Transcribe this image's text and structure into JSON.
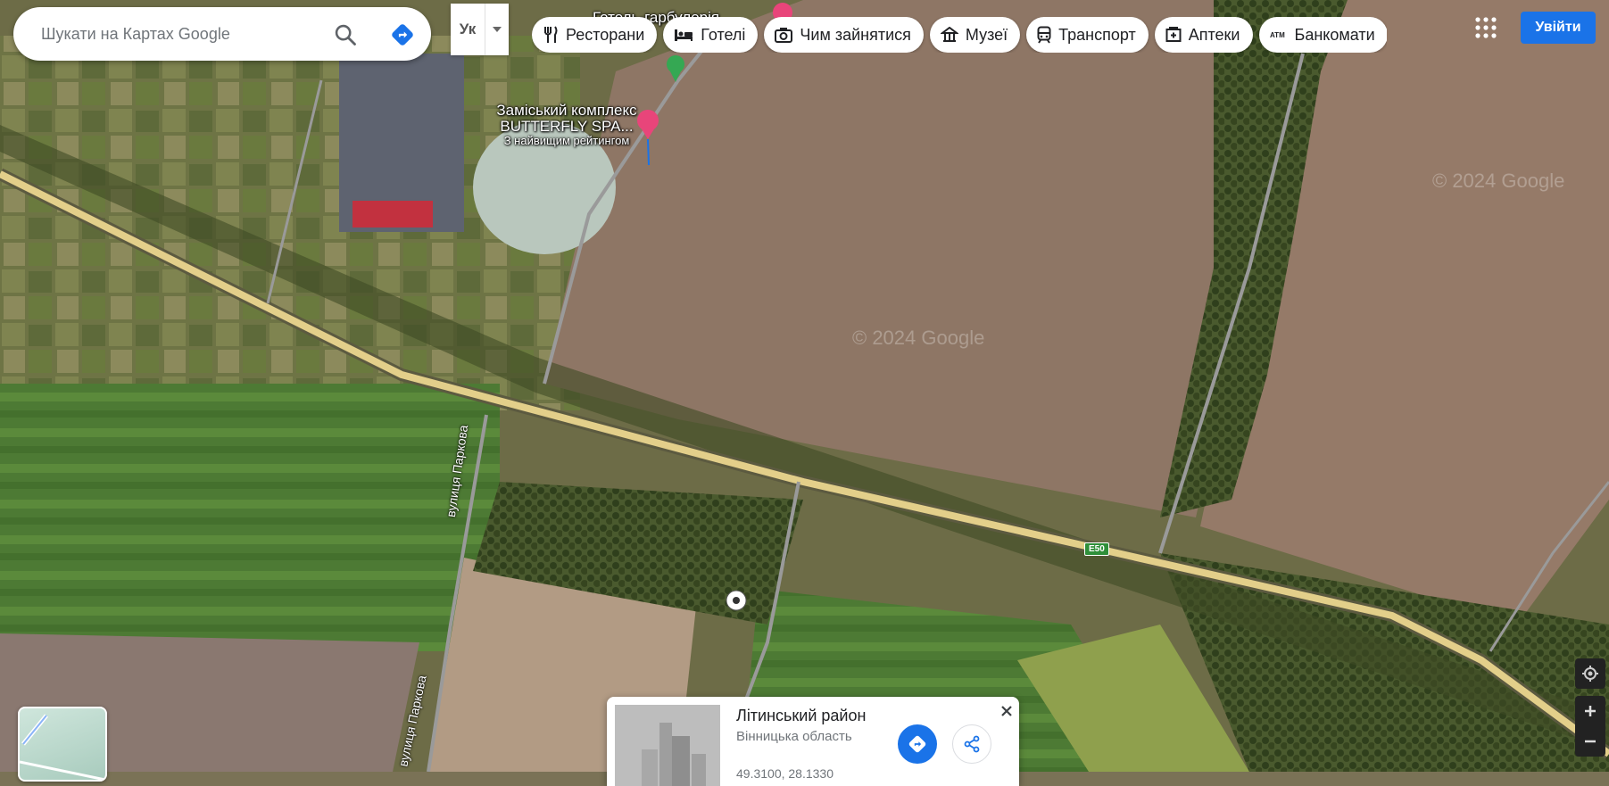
{
  "search": {
    "placeholder": "Шукати на Картах Google"
  },
  "script_toggle": {
    "label": "Ук"
  },
  "chips": [
    {
      "icon": "restaurant-icon",
      "label": "Ресторани"
    },
    {
      "icon": "hotel-icon",
      "label": "Готелі"
    },
    {
      "icon": "camera-icon",
      "label": "Чим зайнятися"
    },
    {
      "icon": "museum-icon",
      "label": "Музеї"
    },
    {
      "icon": "transit-icon",
      "label": "Транспорт"
    },
    {
      "icon": "pharmacy-icon",
      "label": "Аптеки"
    },
    {
      "icon": "atm-icon",
      "label": "Банкомати"
    }
  ],
  "header": {
    "signin_label": "Увійти"
  },
  "map": {
    "top_poi": "Готель-гарбулерія",
    "poi": {
      "name_line1": "Заміський комплекс",
      "name_line2": "BUTTERFLY SPA...",
      "subtitle": "З найвищим рейтингом"
    },
    "street_name": "вулиця Паркова",
    "road_shield": "E50",
    "watermark": "© 2024 Google",
    "colors": {
      "highway": "#e3cf8a",
      "marker_pink": "#e8457a",
      "park_green": "#35a853"
    }
  },
  "card": {
    "title": "Літинський район",
    "subtitle": "Вінницька область",
    "coords": "49.3100, 28.1330"
  },
  "colors": {
    "accent": "#1a73e8"
  }
}
